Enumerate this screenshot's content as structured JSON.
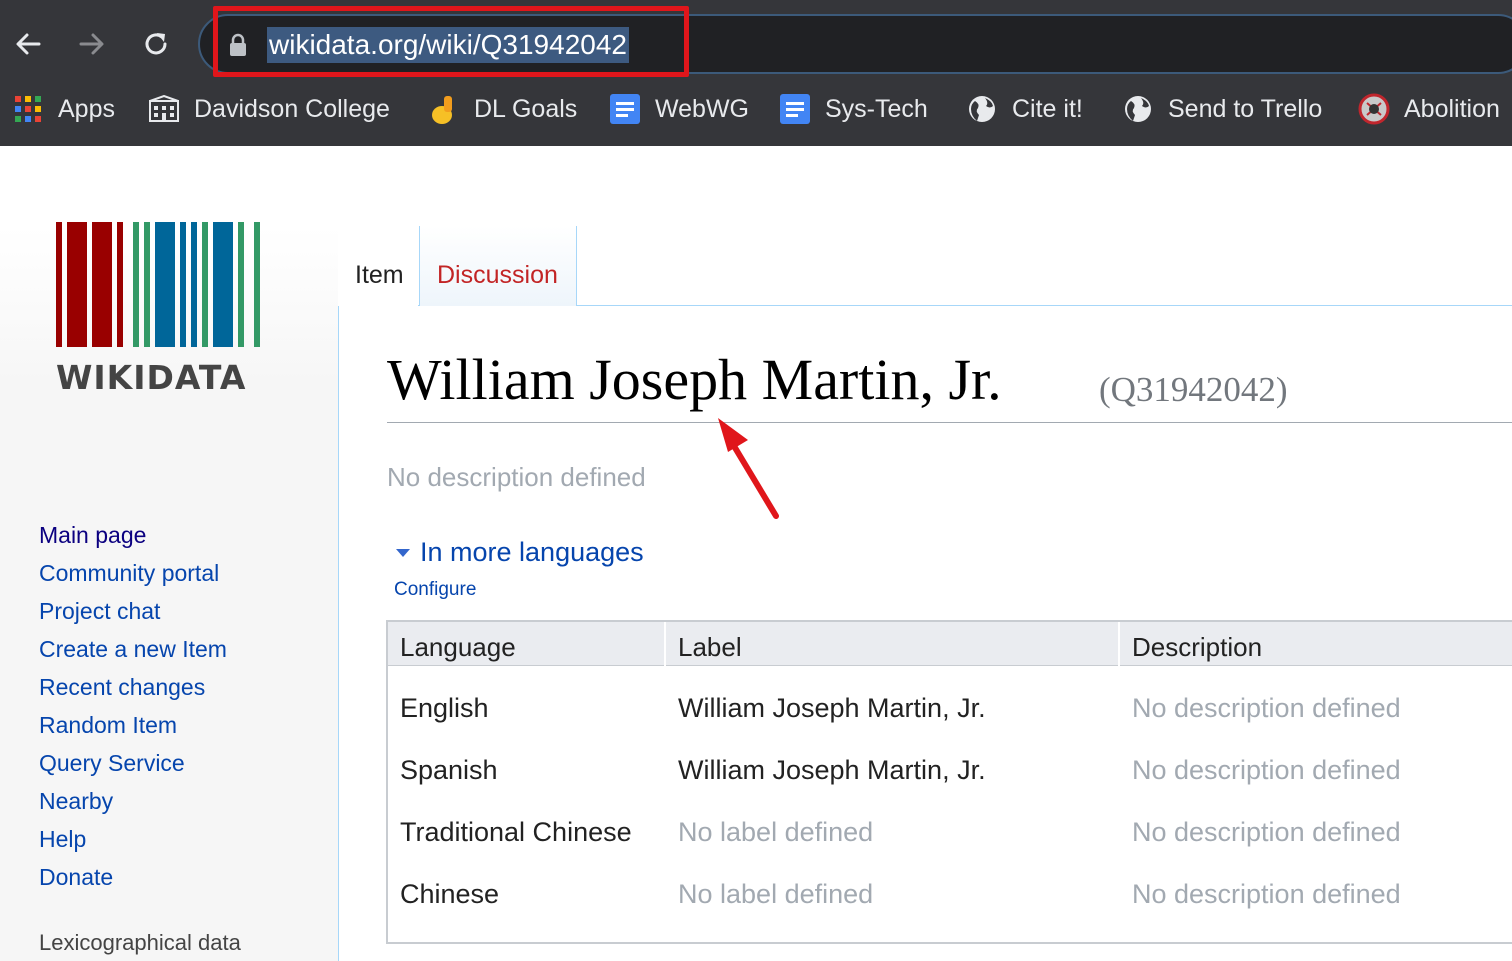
{
  "browser": {
    "url": "wikidata.org/wiki/Q31942042",
    "bookmarks": [
      {
        "label": "Apps",
        "icon": "apps-grid-icon"
      },
      {
        "label": "Davidson College",
        "icon": "building-icon"
      },
      {
        "label": "DL Goals",
        "icon": "goals-icon"
      },
      {
        "label": "WebWG",
        "icon": "google-docs-icon"
      },
      {
        "label": "Sys-Tech",
        "icon": "google-docs-icon"
      },
      {
        "label": "Cite it!",
        "icon": "globe-icon"
      },
      {
        "label": "Send to Trello",
        "icon": "globe-icon"
      },
      {
        "label": "Abolition",
        "icon": "abolition-icon"
      }
    ]
  },
  "sidebar": {
    "logo_text": "WIKIDATA",
    "nav": [
      "Main page",
      "Community portal",
      "Project chat",
      "Create a new Item",
      "Recent changes",
      "Random Item",
      "Query Service",
      "Nearby",
      "Help",
      "Donate"
    ],
    "section_heading": "Lexicographical data"
  },
  "tabs": {
    "item": "Item",
    "discussion": "Discussion"
  },
  "entity": {
    "label": "William Joseph Martin, Jr.",
    "id": "(Q31942042)",
    "description": "No description defined"
  },
  "languages": {
    "toggle_label": "In more languages",
    "configure_label": "Configure",
    "headers": {
      "language": "Language",
      "label": "Label",
      "description": "Description"
    },
    "rows": [
      {
        "language": "English",
        "label": "William Joseph Martin, Jr.",
        "description": "No description defined"
      },
      {
        "language": "Spanish",
        "label": "William Joseph Martin, Jr.",
        "description": "No description defined"
      },
      {
        "language": "Traditional Chinese",
        "label": "No label defined",
        "description": "No description defined"
      },
      {
        "language": "Chinese",
        "label": "No label defined",
        "description": "No description defined"
      }
    ]
  },
  "colors": {
    "annotation_red": "#e0161b",
    "link_blue": "#0645ad",
    "muted_gray": "#a2a9b1"
  }
}
